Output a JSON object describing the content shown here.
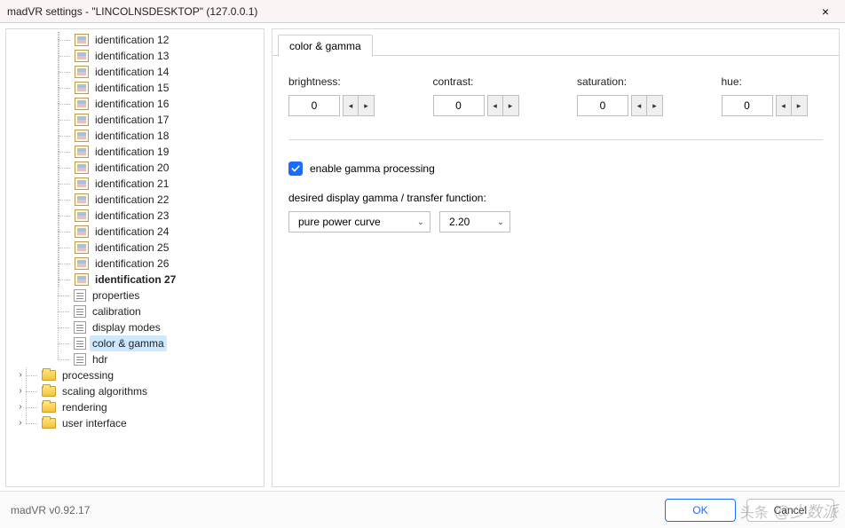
{
  "window": {
    "title": "madVR settings - \"LINCOLNSDESKTOP\" (127.0.0.1)",
    "close_label": "×"
  },
  "tree": {
    "ident_items": [
      "identification 12",
      "identification 13",
      "identification 14",
      "identification 15",
      "identification 16",
      "identification 17",
      "identification 18",
      "identification 19",
      "identification 20",
      "identification 21",
      "identification 22",
      "identification 23",
      "identification 24",
      "identification 25",
      "identification 26",
      "identification 27"
    ],
    "ident_bold_index": 15,
    "device_pages": [
      "properties",
      "calibration",
      "display modes",
      "color & gamma",
      "hdr"
    ],
    "selected_page_index": 3,
    "root_folders": [
      "processing",
      "scaling algorithms",
      "rendering",
      "user interface"
    ]
  },
  "tab": {
    "title": "color & gamma"
  },
  "adjust": {
    "brightness": {
      "label": "brightness:",
      "value": "0"
    },
    "contrast": {
      "label": "contrast:",
      "value": "0"
    },
    "saturation": {
      "label": "saturation:",
      "value": "0"
    },
    "hue": {
      "label": "hue:",
      "value": "0"
    }
  },
  "gamma": {
    "enable_label": "enable gamma processing",
    "enabled": true,
    "desired_label": "desired display gamma / transfer function:",
    "curve": "pure power curve",
    "value": "2.20"
  },
  "footer": {
    "version": "madVR v0.92.17",
    "ok": "OK",
    "cancel": "Cancel"
  },
  "watermark": {
    "a": "头条",
    "b": "@少数派"
  },
  "glyph": {
    "chev_right": "›",
    "tri_left": "◂",
    "tri_right": "▸",
    "chev_down": "⌄"
  }
}
